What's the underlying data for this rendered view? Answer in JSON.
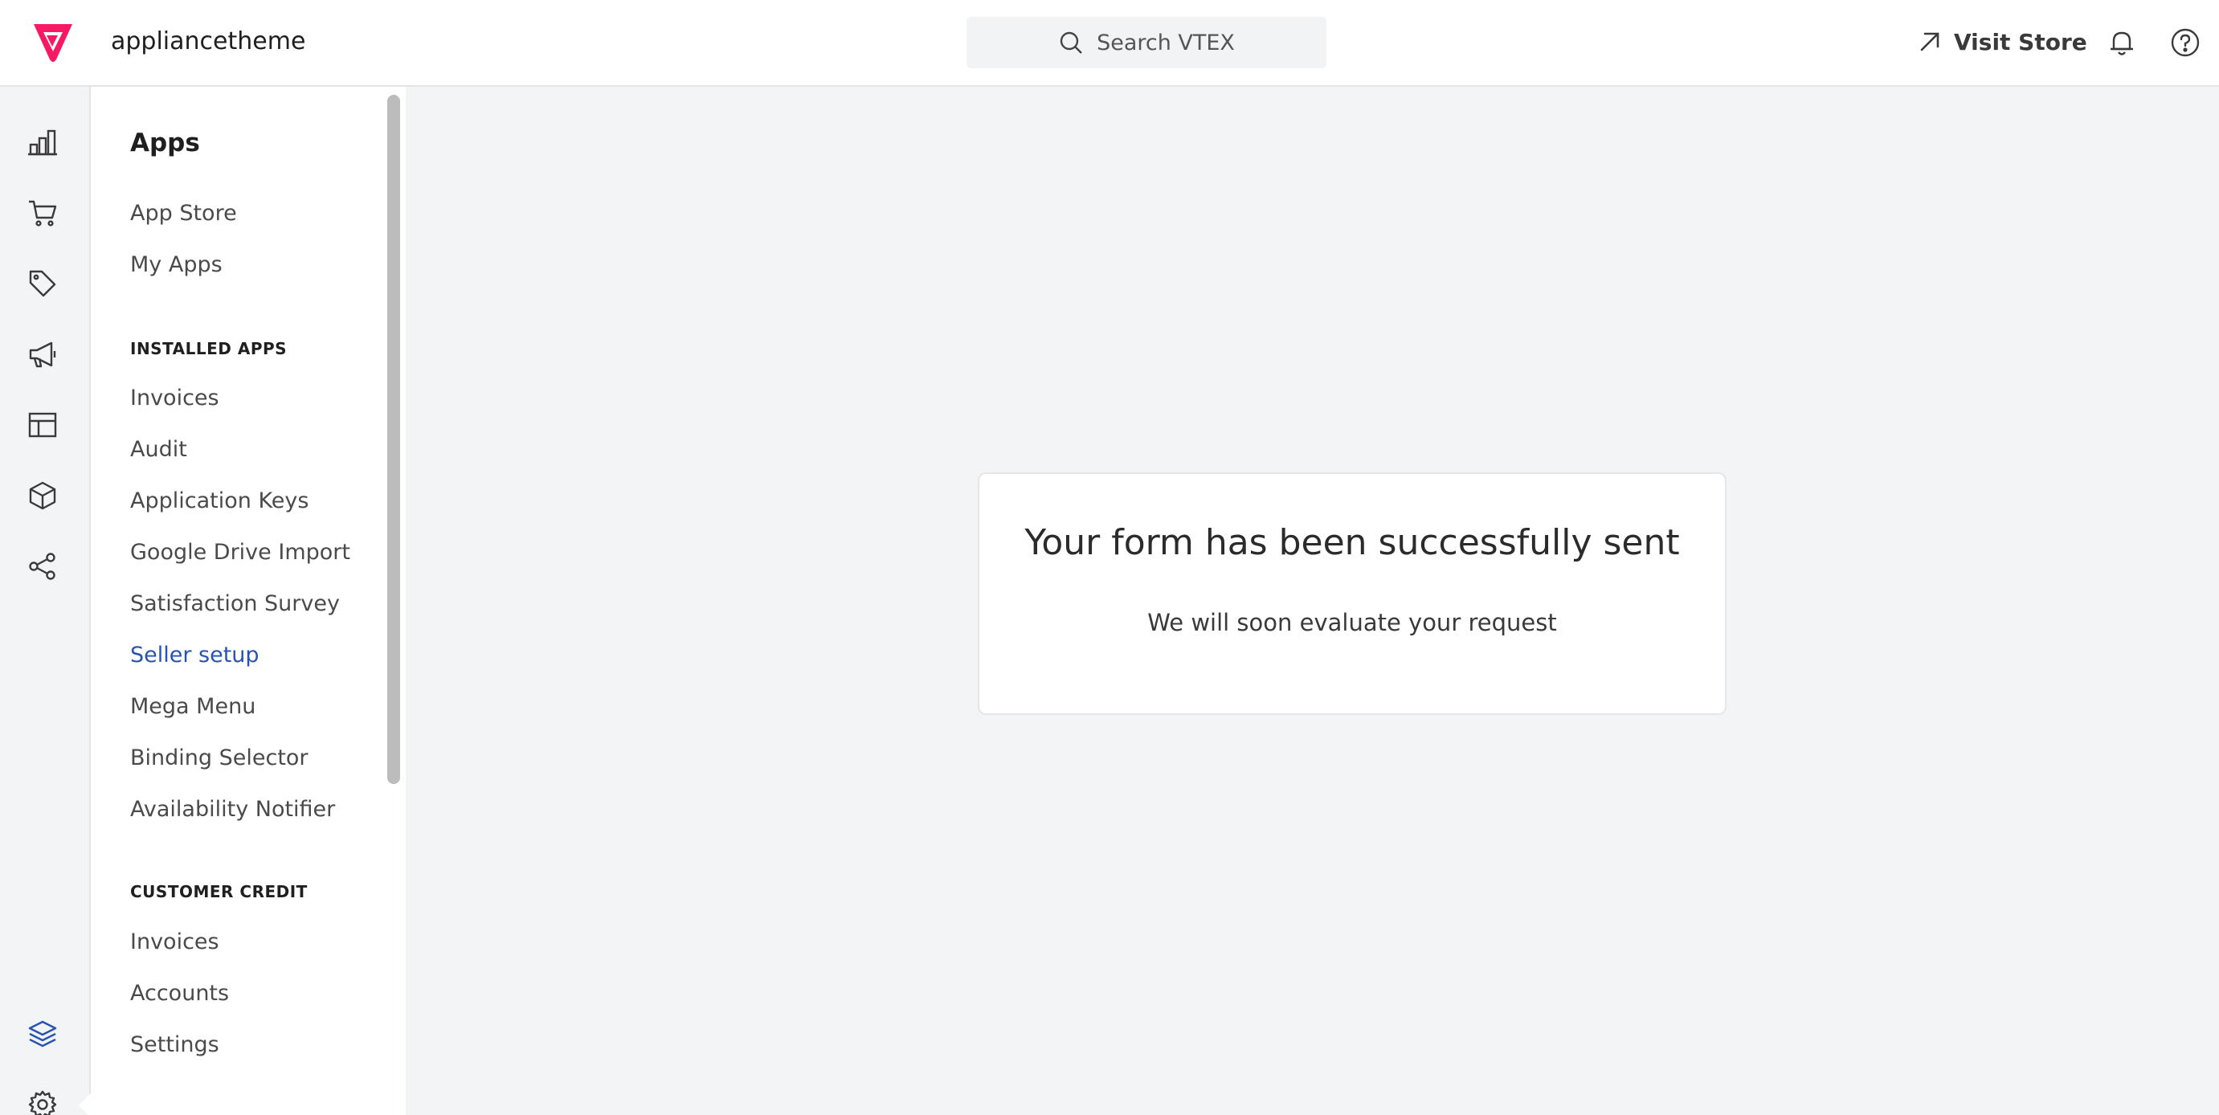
{
  "header": {
    "account_name": "appliancetheme",
    "search_placeholder": "Search VTEX",
    "visit_store_label": "Visit Store"
  },
  "rail": {
    "icons": [
      "dashboard-icon",
      "cart-icon",
      "tag-icon",
      "megaphone-icon",
      "layout-icon",
      "package-icon",
      "share-icon",
      "layers-icon",
      "gear-icon"
    ],
    "active_icon": "layers-icon",
    "active_color": "#2953b2"
  },
  "sidebar": {
    "title": "Apps",
    "top_items": [
      "App Store",
      "My Apps"
    ],
    "installed_section": "INSTALLED APPS",
    "installed_items": [
      "Invoices",
      "Audit",
      "Application Keys",
      "Google Drive Import",
      "Satisfaction Survey",
      "Seller setup",
      "Mega Menu",
      "Binding Selector",
      "Availability Notifier"
    ],
    "active_item": "Seller setup",
    "credit_section": "CUSTOMER CREDIT",
    "credit_items": [
      "Invoices",
      "Accounts",
      "Settings"
    ]
  },
  "card": {
    "title": "Your form has been successfully sent",
    "subtitle": "We will soon evaluate your request"
  },
  "colors": {
    "brand": "#f71963",
    "link_active": "#2953b2"
  }
}
